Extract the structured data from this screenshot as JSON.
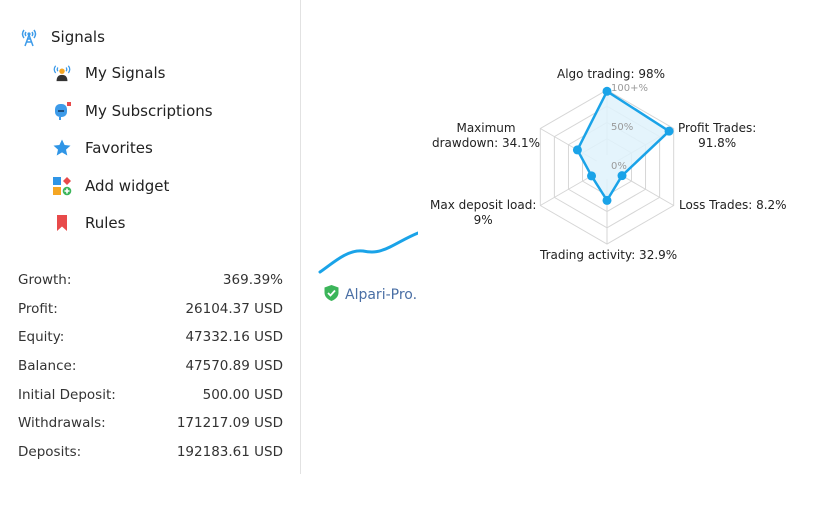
{
  "sidebar": {
    "header": {
      "label": "Signals",
      "icon": "signal-tower-icon"
    },
    "items": [
      {
        "label": "My Signals",
        "icon": "my-signals-icon"
      },
      {
        "label": "My Subscriptions",
        "icon": "mailbox-icon"
      },
      {
        "label": "Favorites",
        "icon": "star-icon"
      },
      {
        "label": "Add widget",
        "icon": "add-widget-icon"
      },
      {
        "label": "Rules",
        "icon": "bookmark-icon"
      }
    ]
  },
  "stats": [
    {
      "label": "Growth:",
      "value": "369.39%"
    },
    {
      "label": "Profit:",
      "value": "26104.37 USD"
    },
    {
      "label": "Equity:",
      "value": "47332.16 USD"
    },
    {
      "label": "Balance:",
      "value": "47570.89 USD"
    },
    {
      "label": "Initial Deposit:",
      "value": "500.00 USD"
    },
    {
      "label": "Withdrawals:",
      "value": "171217.09 USD"
    },
    {
      "label": "Deposits:",
      "value": "192183.61 USD"
    }
  ],
  "signal_card": {
    "broker": "Alpari-Pro.",
    "verified_icon": "verified-shield-icon",
    "line_color": "#1aa3e8"
  },
  "chart_data": {
    "type": "radar",
    "axes": [
      {
        "name": "Algo trading",
        "label_line1": "Algo trading: 98%",
        "label_line2": "",
        "value": 98
      },
      {
        "name": "Profit Trades",
        "label_line1": "Profit Trades:",
        "label_line2": "91.8%",
        "value": 91.8
      },
      {
        "name": "Loss Trades",
        "label_line1": "Loss Trades: 8.2%",
        "label_line2": "",
        "value": 8.2
      },
      {
        "name": "Trading activity",
        "label_line1": "Trading activity: 32.9%",
        "label_line2": "",
        "value": 32.9
      },
      {
        "name": "Max deposit load",
        "label_line1": "Max deposit load:",
        "label_line2": "9%",
        "value": 9
      },
      {
        "name": "Maximum drawdown",
        "label_line1": "Maximum",
        "label_line2": "drawdown: 34.1%",
        "value": 34.1
      }
    ],
    "tick_labels": [
      "0%",
      "50%",
      "100+%"
    ],
    "range": [
      0,
      100
    ],
    "grid_levels": 4,
    "series_color": "#1aa3e8",
    "fill_color": "#dff2fb"
  }
}
